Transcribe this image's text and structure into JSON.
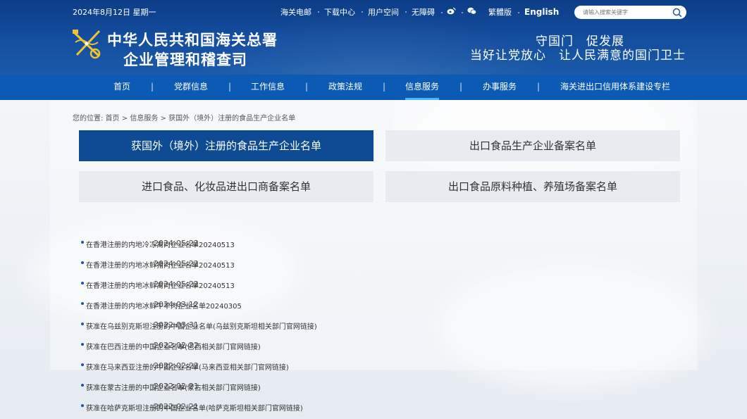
{
  "header": {
    "date": "2024年8月12日 星期一",
    "links": [
      "海关电邮",
      "下载中心",
      "用户空间",
      "无障碍"
    ],
    "icons": [
      "weibo-icon",
      "wechat-icon"
    ],
    "traditional": "繁體版",
    "english": "English",
    "search_placeholder": "请输入搜索关键字",
    "title_line1": "中华人民共和国海关总署",
    "title_line2": "企业管理和稽查司",
    "slogan_line1": "守国门　促发展",
    "slogan_line2": "当好让党放心　让人民满意的国门卫士"
  },
  "nav": {
    "items": [
      "首页",
      "党群信息",
      "工作信息",
      "政策法规",
      "信息服务",
      "办事服务",
      "海关进出口信用体系建设专栏"
    ],
    "separator": "|",
    "active": "信息服务"
  },
  "breadcrumb": {
    "prefix": "您的位置:",
    "items": [
      "首页",
      "信息服务",
      "获国外（境外）注册的食品生产企业名单"
    ],
    "separator": ">"
  },
  "tabs": [
    {
      "label": "获国外（境外）注册的食品生产企业名单",
      "active": true
    },
    {
      "label": "出口食品生产企业备案名单",
      "active": false
    },
    {
      "label": "进口食品、化妆品进出口商备案名单",
      "active": false
    },
    {
      "label": "出口食品原料种植、养殖场备案名单",
      "active": false
    }
  ],
  "list": [
    {
      "title": "在香港注册的内地冷冻禽肉企业名单20240513",
      "date": "2024-05-22"
    },
    {
      "title": "在香港注册的内地冰鲜猪肉企业名单20240513",
      "date": "2024-05-22"
    },
    {
      "title": "在香港注册的内地冰鲜禽肉企业名单20240513",
      "date": "2024-05-22"
    },
    {
      "title": "在香港注册的内地冰鲜牛羊肉企业名单20240305",
      "date": "2024-03-12"
    },
    {
      "title": "获准在乌兹别克斯坦注册的中国企业名单(乌兹别克斯坦相关部门官网链接)",
      "date": "2022-03-31"
    },
    {
      "title": "获准在巴西注册的中国企业名单(巴西相关部门官网链接)",
      "date": "2022-02-22"
    },
    {
      "title": "获准在马来西亚注册的中国企业名单(马来西亚相关部门官网链接)",
      "date": "2022-02-22"
    },
    {
      "title": "获准在蒙古注册的中国企业名单(蒙古相关部门官网链接)",
      "date": "2022-02-21"
    },
    {
      "title": "获准在哈萨克斯坦注册的中国企业名单(哈萨克斯坦相关部门官网链接)",
      "date": "2022-02-21"
    }
  ],
  "colors": {
    "header_dark": "#0c3c86",
    "nav_bar": "#0c5ab3",
    "nav_active_underline": "#4fb4ff",
    "tab_active": "#0e4b93",
    "tab_inactive": "#e8ecf0",
    "bullet": "#1c56a5"
  }
}
